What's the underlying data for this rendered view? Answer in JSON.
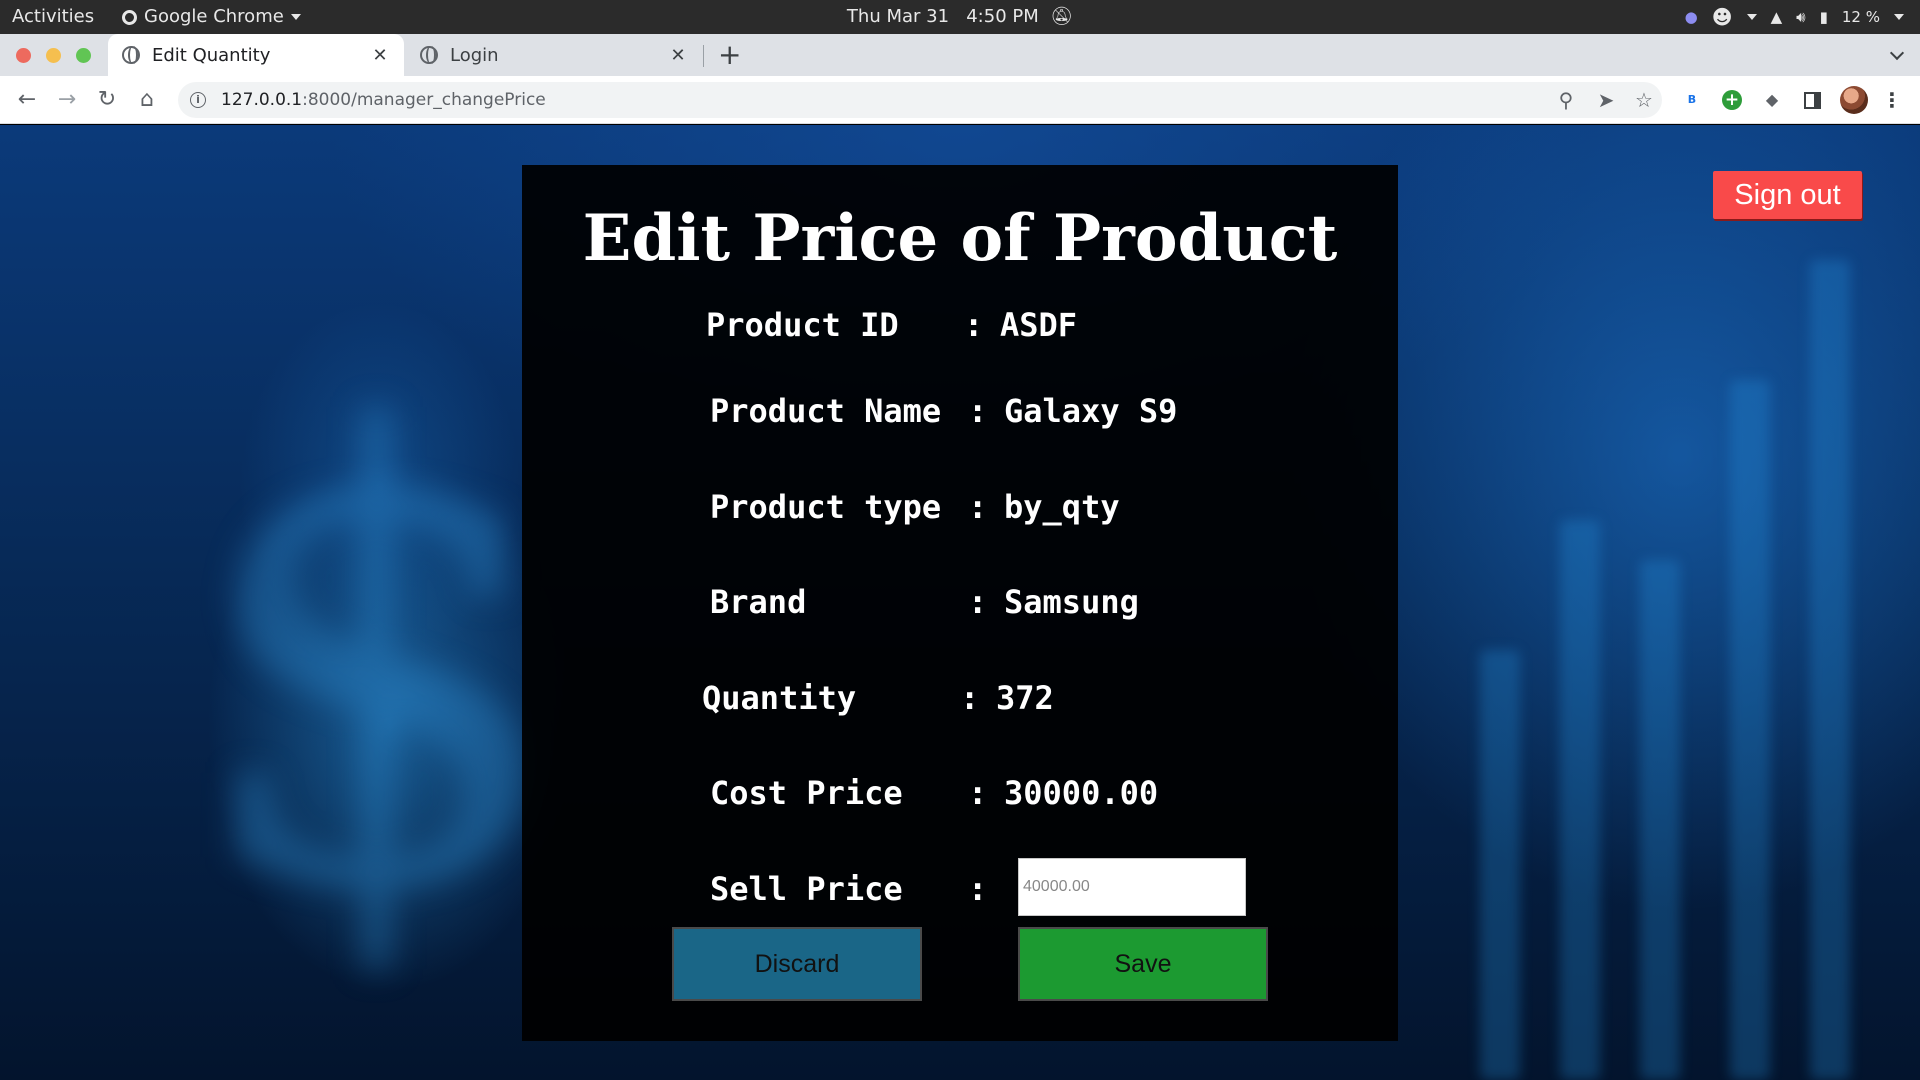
{
  "os_bar": {
    "activities": "Activities",
    "app_name": "Google Chrome",
    "date": "Thu Mar 31",
    "time": "4:50 PM",
    "battery": "12 %"
  },
  "browser": {
    "tabs": [
      {
        "title": "Edit Quantity",
        "active": true
      },
      {
        "title": "Login",
        "active": false
      }
    ],
    "url_host": "127.0.0.1",
    "url_path": ":8000/manager_changePrice"
  },
  "page": {
    "signout_label": "Sign out",
    "title": "Edit Price of Product",
    "fields": {
      "product_id": {
        "label": "Product ID",
        "value": "ASDF"
      },
      "product_name": {
        "label": "Product Name",
        "value": "Galaxy S9"
      },
      "product_type": {
        "label": "Product type",
        "value": "by_qty"
      },
      "brand": {
        "label": "Brand",
        "value": "Samsung"
      },
      "quantity": {
        "label": "Quantity",
        "value": "372"
      },
      "cost_price": {
        "label": "Cost Price",
        "value": "30000.00"
      },
      "sell_price": {
        "label": "Sell Price",
        "placeholder": "40000.00"
      }
    },
    "colon": ":",
    "discard_label": "Discard",
    "save_label": "Save"
  },
  "colors": {
    "signout": "#f94a4a",
    "discard": "#1a6687",
    "save": "#1c9a31",
    "panel": "#000000"
  }
}
